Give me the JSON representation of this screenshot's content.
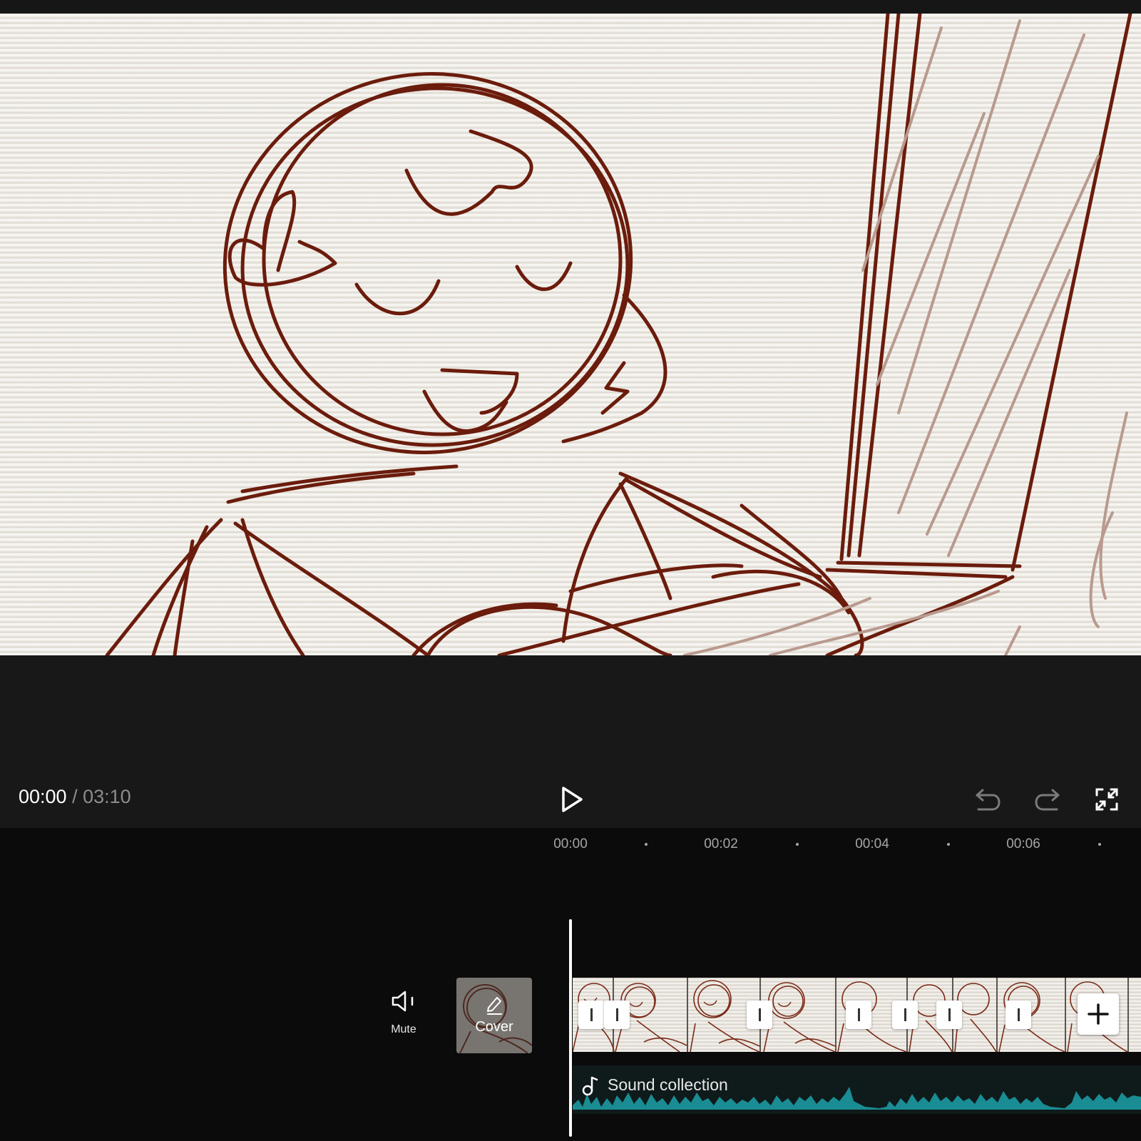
{
  "player": {
    "current_time": "00:00",
    "separator": "/",
    "total_time": "03:10"
  },
  "icons": {
    "play": "play-icon",
    "undo": "undo-icon",
    "redo": "redo-icon",
    "fullscreen": "fullscreen-icon",
    "mute": "speaker-icon",
    "cover_edit": "pencil-icon",
    "add": "plus-icon",
    "audio": "music-note-icon",
    "transition": "transition-icon"
  },
  "ruler": {
    "labels": [
      "00:00",
      "00:02",
      "00:04",
      "00:06"
    ]
  },
  "track_controls": {
    "mute_label": "Mute",
    "cover_label": "Cover"
  },
  "audio_track": {
    "name": "Sound collection",
    "color": "#1a8c93"
  },
  "colors": {
    "sketch": "#6b1c0c",
    "background": "#181818",
    "timeline_bg": "#0b0b0b"
  }
}
